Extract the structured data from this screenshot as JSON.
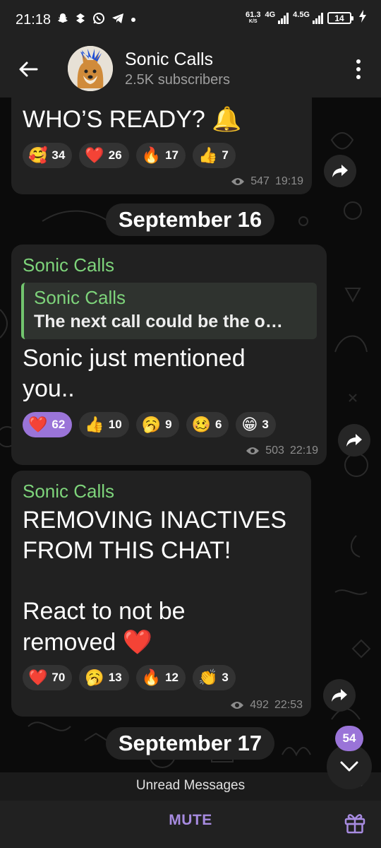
{
  "status_bar": {
    "time": "21:18",
    "notif_icons": [
      "snapchat-icon",
      "dropbox-icon",
      "whatsapp-icon",
      "telegram-icon",
      "dot-icon"
    ],
    "net_speed_value": "61.3",
    "net_speed_unit": "K/S",
    "net_type_1": "4G",
    "net_type_2": "4.5G",
    "battery": "14"
  },
  "header": {
    "title": "Sonic Calls",
    "subtitle": "2.5K subscribers"
  },
  "messages": [
    {
      "text": "WHO’S READY? 🔔",
      "reactions": [
        {
          "emoji": "🥰",
          "count": "34",
          "active": false
        },
        {
          "emoji": "❤️",
          "count": "26",
          "active": false
        },
        {
          "emoji": "🔥",
          "count": "17",
          "active": false
        },
        {
          "emoji": "👍",
          "count": "7",
          "active": false
        }
      ],
      "views": "547",
      "time": "19:19"
    },
    {
      "sender": "Sonic Calls",
      "quote_name": "Sonic Calls",
      "quote_text": "The next call could be the o…",
      "text_lines": [
        "Sonic just mentioned",
        "you.."
      ],
      "reactions": [
        {
          "emoji": "❤️",
          "count": "62",
          "active": true
        },
        {
          "emoji": "👍",
          "count": "10",
          "active": false
        },
        {
          "emoji": "🥱",
          "count": "9",
          "active": false
        },
        {
          "emoji": "🥴",
          "count": "6",
          "active": false
        },
        {
          "emoji": "😁",
          "count": "3",
          "active": false
        }
      ],
      "views": "503",
      "time": "22:19"
    },
    {
      "sender": "Sonic Calls",
      "text_lines": [
        "REMOVING INACTIVES",
        "FROM THIS CHAT!",
        "",
        "React to not be",
        "removed ❤️"
      ],
      "reactions": [
        {
          "emoji": "❤️",
          "count": "70",
          "active": false
        },
        {
          "emoji": "🥱",
          "count": "13",
          "active": false
        },
        {
          "emoji": "🔥",
          "count": "12",
          "active": false
        },
        {
          "emoji": "👏",
          "count": "3",
          "active": false
        }
      ],
      "views": "492",
      "time": "22:53"
    }
  ],
  "date_separators": [
    "September 16",
    "September 17"
  ],
  "unread_badge": "54",
  "unread_bar_label": "Unread Messages",
  "bottom": {
    "mute_label": "MUTE"
  },
  "colors": {
    "accent": "#9a74d8",
    "sender_green": "#7ed47b",
    "bubble": "#212121",
    "header": "#212121"
  }
}
